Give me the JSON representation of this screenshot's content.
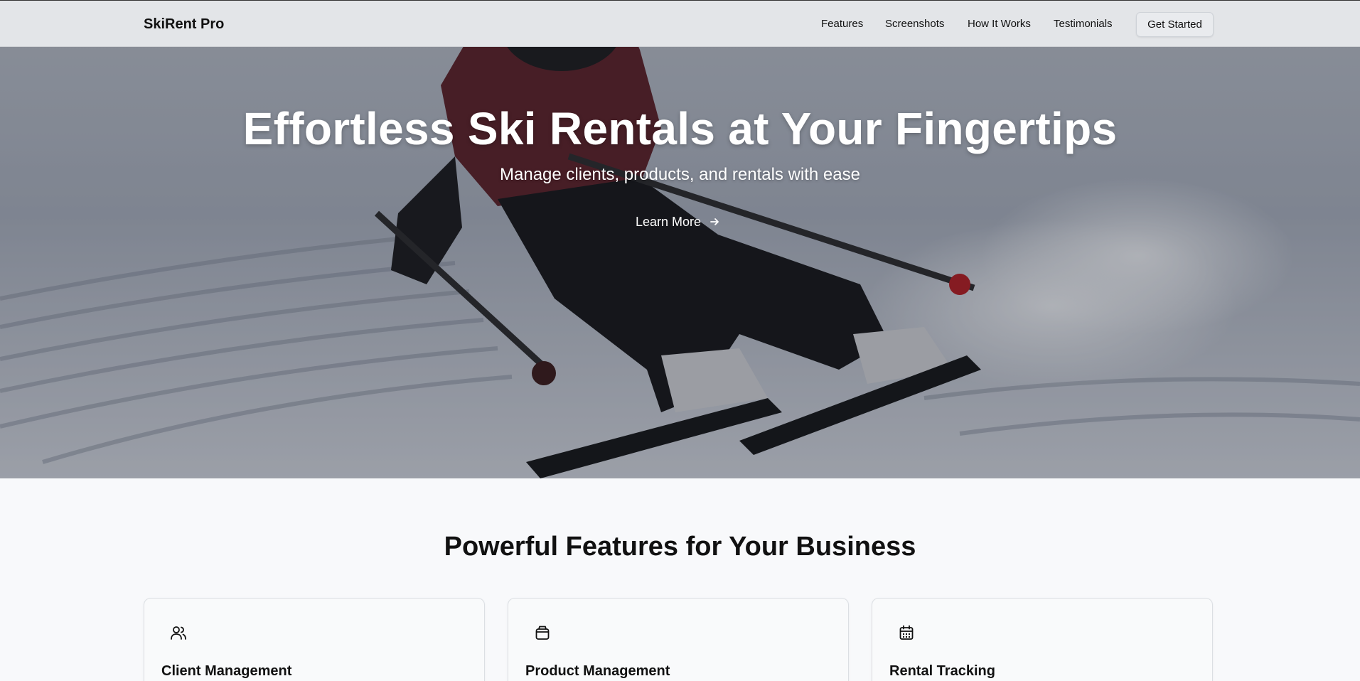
{
  "nav": {
    "brand": "SkiRent Pro",
    "links": [
      "Features",
      "Screenshots",
      "How It Works",
      "Testimonials"
    ],
    "cta": "Get Started"
  },
  "hero": {
    "title": "Effortless Ski Rentals at Your Fingertips",
    "subtitle": "Manage clients, products, and rentals with ease",
    "button": "Learn More"
  },
  "features": {
    "title": "Powerful Features for Your Business",
    "cards": [
      {
        "icon": "users-icon",
        "title": "Client Management"
      },
      {
        "icon": "box-icon",
        "title": "Product Management"
      },
      {
        "icon": "calendar-icon",
        "title": "Rental Tracking"
      }
    ]
  },
  "colors": {
    "nav_bg": "#e2e4e7",
    "page_bg": "#f8f9fb",
    "text": "#111111",
    "hero_text": "#ffffff"
  }
}
